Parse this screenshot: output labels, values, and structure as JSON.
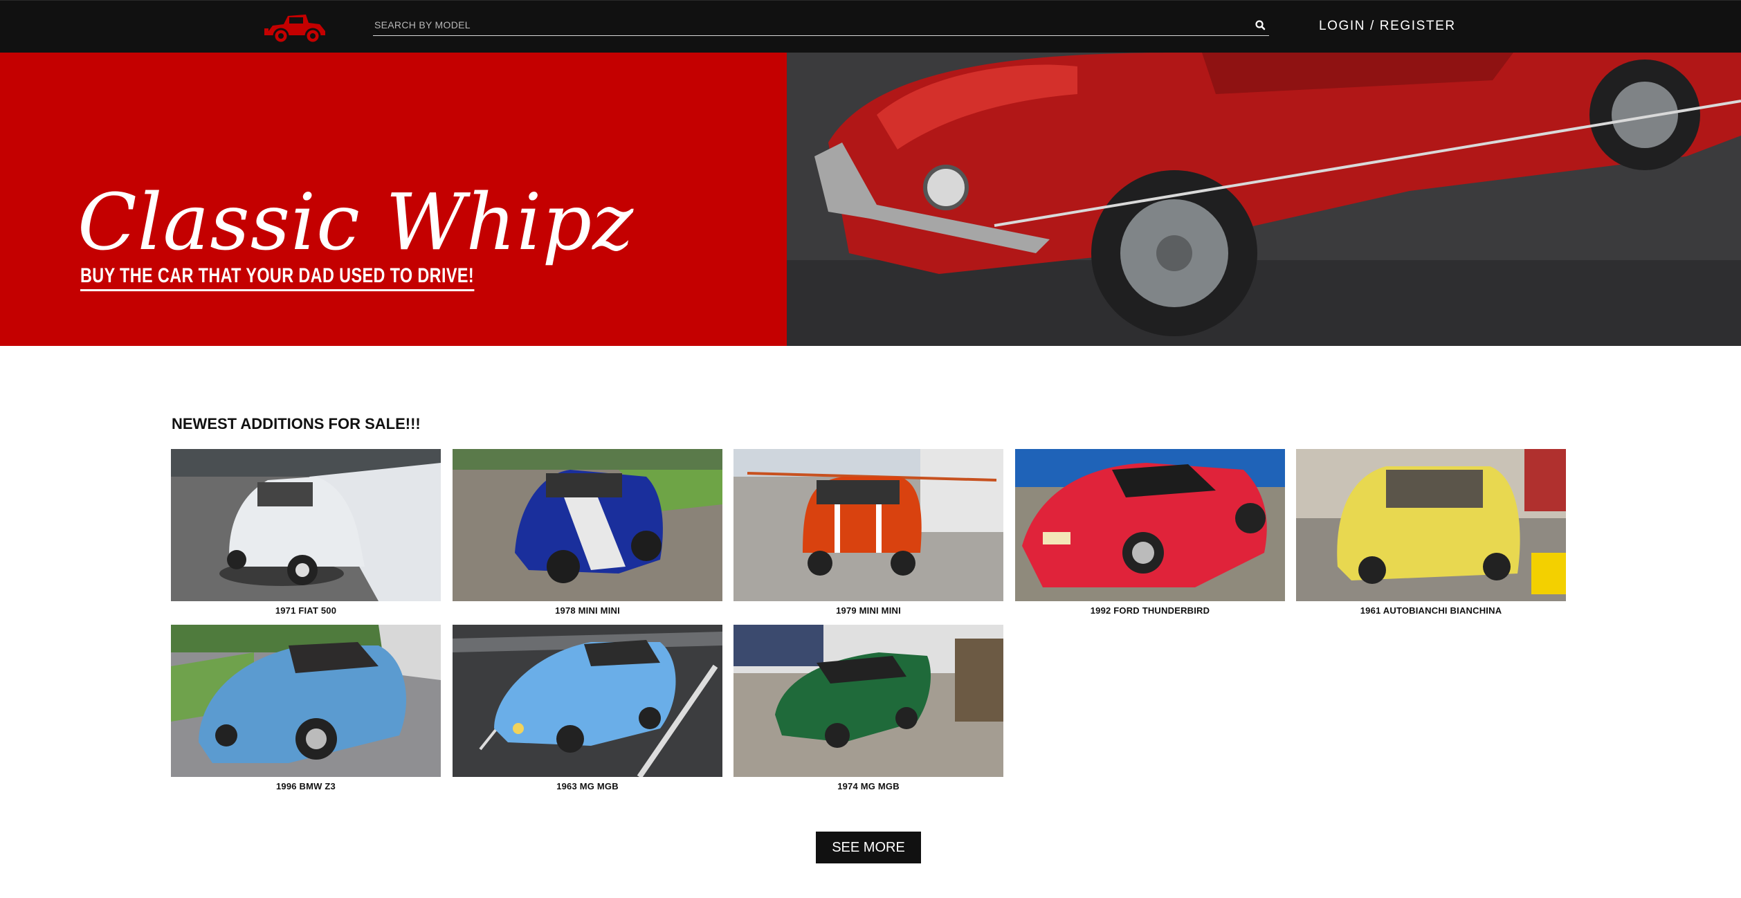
{
  "nav": {
    "logo_icon": "vintage-car-icon",
    "search_placeholder": "SEARCH BY MODEL",
    "search_icon": "search-icon",
    "login_label": "LOGIN / REGISTER"
  },
  "hero": {
    "brand_title": "Classic Whipz",
    "brand_tagline": "BUY THE CAR THAT YOUR DAD USED TO DRIVE!",
    "brand_color": "#c40000"
  },
  "listings": {
    "title": "NEWEST ADDITIONS FOR SALE!!!",
    "cars": [
      {
        "name": "1971 FIAT 500",
        "color": "#e9ecef"
      },
      {
        "name": "1978 MINI MINI",
        "color": "#1a2f9c"
      },
      {
        "name": "1979 MINI MINI",
        "color": "#d9420f"
      },
      {
        "name": "1992 FORD THUNDERBIRD",
        "color": "#e0233a"
      },
      {
        "name": "1961 AUTOBIANCHI BIANCHINA",
        "color": "#e8d850"
      },
      {
        "name": "1996 BMW Z3",
        "color": "#5b9bd0"
      },
      {
        "name": "1963 MG MGB",
        "color": "#6aaee8"
      },
      {
        "name": "1974 MG MGB",
        "color": "#1f6a3a"
      }
    ],
    "see_more_label": "SEE MORE"
  }
}
